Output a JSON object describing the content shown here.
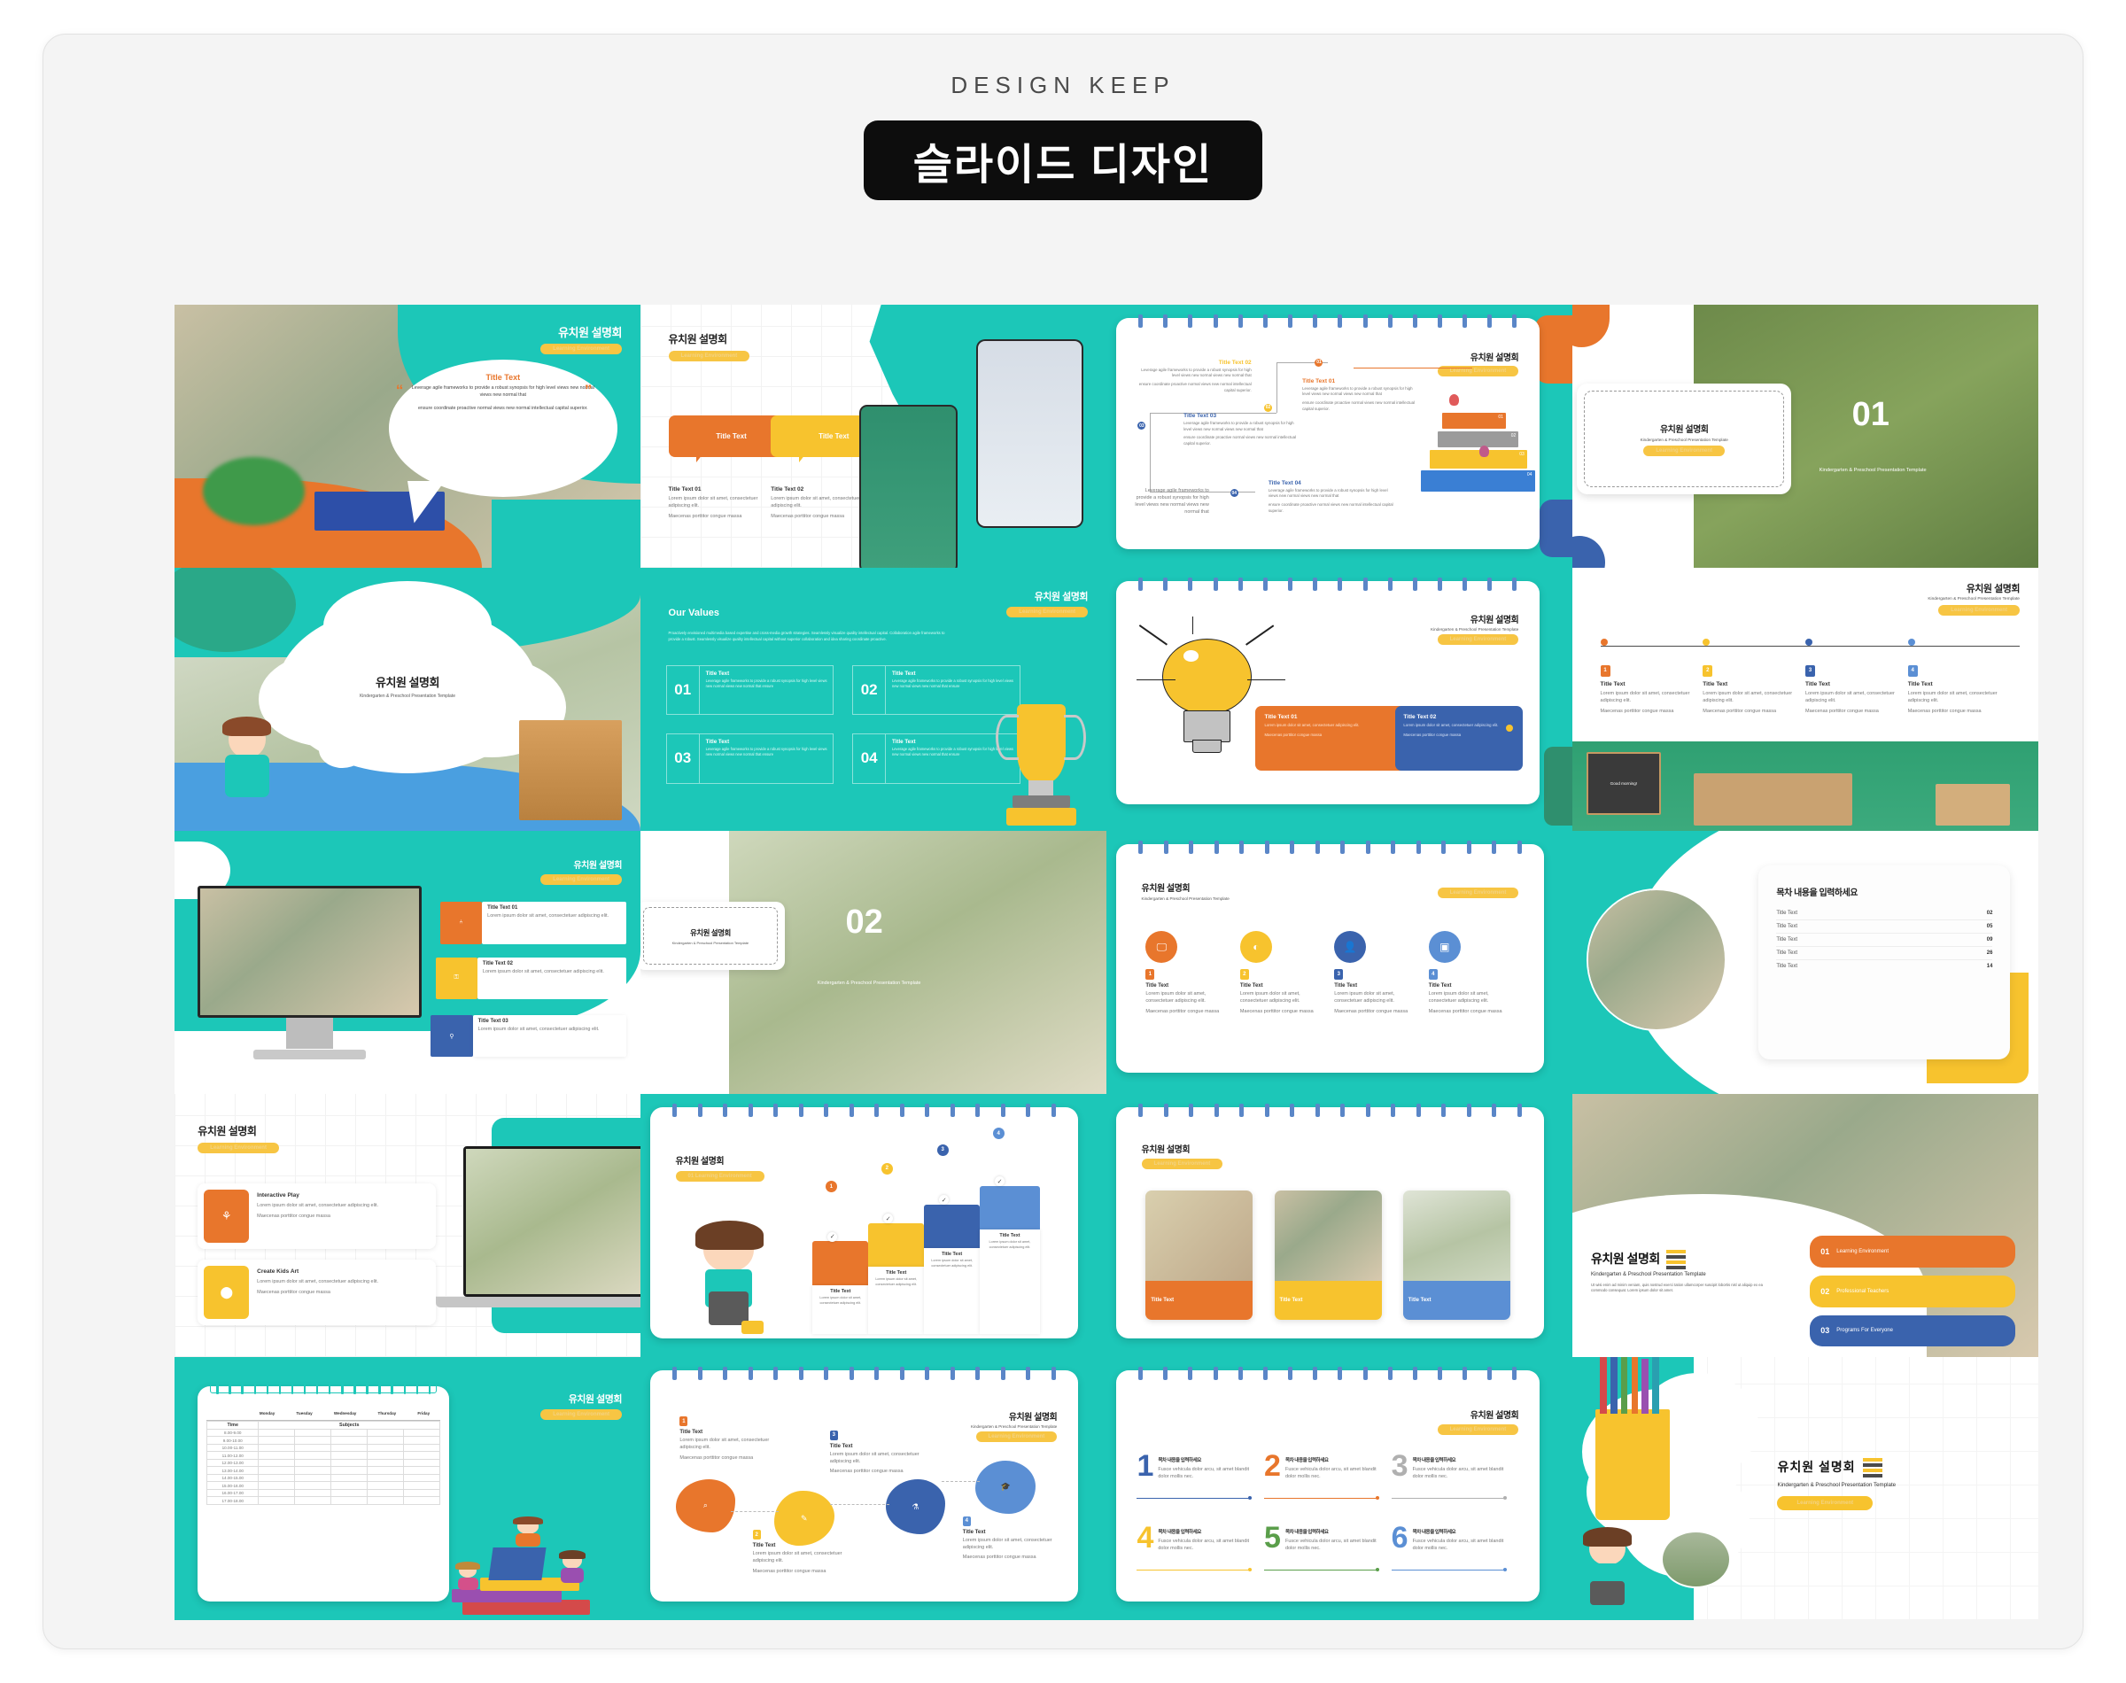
{
  "header": {
    "brand": "DESIGN KEEP",
    "title": "슬라이드 디자인"
  },
  "common": {
    "kor_title": "유치원 설명회",
    "eng_sub": "Kindergarten & Preschool Presentation Template",
    "badge": "Learning Environment",
    "lorem_short": "Lorem ipsum dolor sit amet, consectetuer adipiscing elit.",
    "lorem_maecenas": "Maecenas porttitor congue massa",
    "lorem_long": "Leverage agile frameworks to provide a robust synopsis for high level views new normal views new normal that",
    "lorem_long2": "ensure coordinate proactive normal views new normal intellectual capital superior.",
    "fusce": "Fusce vehicula dolor arcu, sit amet blandit dolor mollis nec."
  },
  "colors": {
    "teal": "#1cc7b8",
    "orange": "#e8762c",
    "yellow": "#f7c32e",
    "blue": "#3a63ad",
    "light_blue": "#5b8fd4",
    "black": "#0d0d0d"
  },
  "slides": [
    {
      "id": "s01",
      "name": "quote-speech-bubble-slide",
      "title": "유치원 설명회",
      "badge": "Learning Environment",
      "quote_title": "Title Text",
      "quote_body_1": "Leverage agile frameworks to provide a robust synopsis for high level views new normal views new normal that",
      "quote_body_2": "ensure coordinate proactive normal views new normal intellectual capital superior."
    },
    {
      "id": "s02",
      "name": "mobile-mockup-two-bubble-slide",
      "title": "유치원 설명회",
      "badge": "Learning Environment",
      "bubbles": [
        "Title Text",
        "Title Text"
      ],
      "items": [
        {
          "heading": "Title Text 01",
          "body": "Lorem ipsum dolor sit amet, consectetuer adipiscing elit.",
          "body2": "Maecenas porttitor congue massa"
        },
        {
          "heading": "Title Text 02",
          "body": "Lorem ipsum dolor sit amet, consectetuer adipiscing elit.",
          "body2": "Maecenas porttitor congue massa"
        }
      ]
    },
    {
      "id": "s03",
      "name": "tree-diagram-four-step-slide",
      "title": "유치원 설명회",
      "badge": "Learning Environment",
      "nodes": [
        {
          "num": "01",
          "heading": "Title Text 01",
          "color": "#e8762c"
        },
        {
          "num": "02",
          "heading": "Title Text 02",
          "color": "#f7c32e"
        },
        {
          "num": "03",
          "heading": "Title Text 03",
          "color": "#3a63ad"
        },
        {
          "num": "04",
          "heading": "Title Text 04",
          "color": "#3a63ad"
        }
      ],
      "body_a": "Leverage agile frameworks to provide a robust synopsis for high level views new normal views new normal that",
      "body_b": "ensure coordinate proactive normal views new normal intellectual capital superior.",
      "blocks": [
        "01",
        "02",
        "03",
        "04"
      ]
    },
    {
      "id": "s04",
      "name": "section-divider-01-slide",
      "title": "유치원 설명회",
      "sub": "Kindergarten & Preschool Presentation Template",
      "badge": "Learning Environment",
      "big_number": "01",
      "overlay_caption": "Kindergarten & Preschool Presentation Template"
    },
    {
      "id": "s05",
      "name": "cloud-cover-title-slide",
      "title": "유치원 설명회",
      "sub": "Kindergarten & Preschool Presentation Template"
    },
    {
      "id": "s06",
      "name": "our-values-four-box-slide",
      "title": "유치원 설명회",
      "badge": "Learning Environment",
      "section_title": "Our Values",
      "intro": "Proactively envisioned multimedia based expertise and cross-media growth strategies. Seamlessly visualize quality intellectual capital. Collaboration agile frameworks to provide a robust. Seamlessly visualize quality intellectual capital without superior collaboration and idea sharing coordinate proactive.",
      "boxes": [
        {
          "num": "01",
          "heading": "Title Text",
          "body": "Leverage agile frameworks to provide a robust synopsis for high level views new normal views new normal that ensure"
        },
        {
          "num": "02",
          "heading": "Title Text",
          "body": "Leverage agile frameworks to provide a robust synopsis for high level views new normal views new normal that ensure"
        },
        {
          "num": "03",
          "heading": "Title Text",
          "body": "Leverage agile frameworks to provide a robust synopsis for high level views new normal views new normal that ensure"
        },
        {
          "num": "04",
          "heading": "Title Text",
          "body": "Leverage agile frameworks to provide a robust synopsis for high level views new normal views new normal that ensure"
        }
      ]
    },
    {
      "id": "s07",
      "name": "lightbulb-two-card-slide",
      "title": "유치원 설명회",
      "sub": "Kindergarten & Preschool Presentation Template",
      "badge": "Learning Environment",
      "cards": [
        {
          "heading": "Title Text 01",
          "body": "Lorem ipsum dolor sit amet, consectetuer adipiscing elit.",
          "body2": "Maecenas porttitor congue massa",
          "color": "#e8762c"
        },
        {
          "heading": "Title Text 02",
          "body": "Lorem ipsum dolor sit amet, consectetuer adipiscing elit.",
          "body2": "Maecenas porttitor congue massa",
          "color": "#3a63ad"
        }
      ]
    },
    {
      "id": "s08",
      "name": "horizontal-timeline-four-step-slide",
      "title": "유치원 설명회",
      "sub": "Kindergarten & Preschool Presentation Template",
      "badge": "Learning Environment",
      "steps": [
        {
          "num": "1",
          "heading": "Title Text",
          "body": "Lorem ipsum dolor sit amet, consectetuer adipiscing elit.",
          "body2": "Maecenas porttitor congue massa",
          "color": "#e8762c"
        },
        {
          "num": "2",
          "heading": "Title Text",
          "body": "Lorem ipsum dolor sit amet, consectetuer adipiscing elit.",
          "body2": "Maecenas porttitor congue massa",
          "color": "#f7c32e"
        },
        {
          "num": "3",
          "heading": "Title Text",
          "body": "Lorem ipsum dolor sit amet, consectetuer adipiscing elit.",
          "body2": "Maecenas porttitor congue massa",
          "color": "#3a63ad"
        },
        {
          "num": "4",
          "heading": "Title Text",
          "body": "Lorem ipsum dolor sit amet, consectetuer adipiscing elit.",
          "body2": "Maecenas porttitor congue massa",
          "color": "#5b8fd4"
        }
      ],
      "blackboard_text": "Good morning!"
    },
    {
      "id": "s09",
      "name": "monitor-puzzle-three-item-slide",
      "title": "유치원 설명회",
      "badge": "Learning Environment",
      "items": [
        {
          "heading": "Title Text 01",
          "body": "Lorem ipsum dolor sit amet, consectetuer adipiscing elit.",
          "icon": "cutlery-icon",
          "color": "#e8762c"
        },
        {
          "heading": "Title Text 02",
          "body": "Lorem ipsum dolor sit amet, consectetuer adipiscing elit.",
          "icon": "key-icon",
          "color": "#f7c32e"
        },
        {
          "heading": "Title Text 03",
          "body": "Lorem ipsum dolor sit amet, consectetuer adipiscing elit.",
          "icon": "magnifier-icon",
          "color": "#3a63ad"
        }
      ]
    },
    {
      "id": "s10",
      "name": "section-divider-02-slide",
      "title": "유치원 설명회",
      "sub": "Kindergarten & Preschool Presentation Template",
      "big_number": "02",
      "overlay_caption": "Kindergarten & Preschool Presentation Template"
    },
    {
      "id": "s11",
      "name": "four-circle-icon-slide",
      "title": "유치원 설명회",
      "sub": "Kindergarten & Preschool Presentation Template",
      "badge": "Learning Environment",
      "items": [
        {
          "num": "1",
          "heading": "Title Text",
          "body": "Lorem ipsum dolor sit amet, consectetuer adipiscing elit.",
          "body2": "Maecenas porttitor congue massa",
          "icon": "monitor-icon",
          "color": "#e8762c"
        },
        {
          "num": "2",
          "heading": "Title Text",
          "body": "Lorem ipsum dolor sit amet, consectetuer adipiscing elit.",
          "body2": "Maecenas porttitor congue massa",
          "icon": "palette-icon",
          "color": "#f7c32e"
        },
        {
          "num": "3",
          "heading": "Title Text",
          "body": "Lorem ipsum dolor sit amet, consectetuer adipiscing elit.",
          "body2": "Maecenas porttitor congue massa",
          "icon": "teacher-icon",
          "color": "#3a63ad"
        },
        {
          "num": "4",
          "heading": "Title Text",
          "body": "Lorem ipsum dolor sit amet, consectetuer adipiscing elit.",
          "body2": "Maecenas porttitor congue massa",
          "icon": "presentation-icon",
          "color": "#5b8fd4"
        }
      ]
    },
    {
      "id": "s12",
      "name": "table-of-contents-slide",
      "toc_title": "목차 내용을 입력하세요",
      "rows": [
        {
          "label": "Title Text",
          "page": "02"
        },
        {
          "label": "Title Text",
          "page": "05"
        },
        {
          "label": "Title Text",
          "page": "09"
        },
        {
          "label": "Title Text",
          "page": "26"
        },
        {
          "label": "Title Text",
          "page": "14"
        }
      ]
    },
    {
      "id": "s13",
      "name": "laptop-two-feature-slide",
      "title": "유치원 설명회",
      "badge": "Learning Environment",
      "features": [
        {
          "heading": "Interactive Play",
          "body": "Lorem ipsum dolor sit amet, consectetuer adipiscing elit.",
          "body2": "Maecenas porttitor congue massa",
          "icon": "rocking-horse-icon",
          "color": "#e8762c"
        },
        {
          "heading": "Create Kids Art",
          "body": "Lorem ipsum dolor sit amet, consectetuer adipiscing elit.",
          "body2": "Maecenas porttitor congue massa",
          "icon": "basketball-icon",
          "color": "#f7c32e"
        }
      ]
    },
    {
      "id": "s14",
      "name": "staircase-four-step-slide",
      "title": "유치원 설명회",
      "badge": "01 Learning Environment",
      "steps": [
        {
          "num": "1",
          "heading": "Title Text",
          "body": "Lorem ipsum dolor sit amet, consectetuer adipiscing elit.",
          "body2": "Maecenas porttitor congue massa",
          "color": "#e8762c"
        },
        {
          "num": "2",
          "heading": "Title Text",
          "body": "Lorem ipsum dolor sit amet, consectetuer adipiscing elit.",
          "body2": "Maecenas porttitor congue massa",
          "color": "#f7c32e"
        },
        {
          "num": "3",
          "heading": "Title Text",
          "body": "Lorem ipsum dolor sit amet, consectetuer adipiscing elit.",
          "body2": "Maecenas porttitor congue massa",
          "color": "#3a63ad"
        },
        {
          "num": "4",
          "heading": "Title Text",
          "body": "Lorem ipsum dolor sit amet, consectetuer adipiscing elit.",
          "body2": "Maecenas porttitor congue massa",
          "color": "#5b8fd4"
        }
      ]
    },
    {
      "id": "s15",
      "name": "three-photo-card-slide",
      "title": "유치원 설명회",
      "badge": "Learning Environment",
      "cards": [
        {
          "heading": "Title Text",
          "color": "#e8762c"
        },
        {
          "heading": "Title Text",
          "color": "#f7c32e"
        },
        {
          "heading": "Title Text",
          "color": "#5b8fd4"
        }
      ]
    },
    {
      "id": "s16",
      "name": "hero-three-pill-slide",
      "title": "유치원 설명회",
      "sub": "Kindergarten & Preschool Presentation Template",
      "body": "Ut wisi enim ad minim veniam, quis nostrud exerci tation ullamcorper suscipit lobortis nisl ut aliquip ex ea commodo consequat. Lorem ipsum dolor sit amet.",
      "pills": [
        {
          "num": "01",
          "label": "Learning Environment",
          "color": "#e8762c"
        },
        {
          "num": "02",
          "label": "Professional Teachers",
          "color": "#f7c32e"
        },
        {
          "num": "03",
          "label": "Programs For Everyone",
          "color": "#3a63ad"
        }
      ]
    },
    {
      "id": "s17",
      "name": "weekly-schedule-table-slide",
      "title": "유치원 설명회",
      "badge": "Learning Environment",
      "days": [
        "Monday",
        "Tuesday",
        "Wednesday",
        "Thursday",
        "Friday"
      ],
      "col_time": "Time",
      "col_subjects": "Subjects",
      "times": [
        "8.00-9.00",
        "9.00-10.00",
        "10.00-11.00",
        "11.00-12.00",
        "12.00-13.00",
        "13.00-14.00",
        "14.00-15.00",
        "15.00-16.00",
        "16.00-17.00",
        "17.00-18.00"
      ]
    },
    {
      "id": "s18",
      "name": "zigzag-four-blob-slide",
      "title": "유치원 설명회",
      "sub": "Kindergarten & Preschool Presentation Template",
      "badge": "Learning Environment",
      "nodes": [
        {
          "num": "1",
          "heading": "Title Text",
          "body": "Lorem ipsum dolor sit amet, consectetuer adipiscing elit.",
          "body2": "Maecenas porttitor congue massa",
          "icon": "book-search-icon",
          "color": "#e8762c"
        },
        {
          "num": "2",
          "heading": "Title Text",
          "body": "Lorem ipsum dolor sit amet, consectetuer adipiscing elit.",
          "body2": "Maecenas porttitor congue massa",
          "icon": "pencil-icon",
          "color": "#f7c32e"
        },
        {
          "num": "3",
          "heading": "Title Text",
          "body": "Lorem ipsum dolor sit amet, consectetuer adipiscing elit.",
          "body2": "Maecenas porttitor congue massa",
          "icon": "flask-icon",
          "color": "#3a63ad"
        },
        {
          "num": "4",
          "heading": "Title Text",
          "body": "Lorem ipsum dolor sit amet, consectetuer adipiscing elit.",
          "body2": "Maecenas porttitor congue massa",
          "icon": "graduation-cap-icon",
          "color": "#5b8fd4"
        }
      ]
    },
    {
      "id": "s19",
      "name": "six-number-list-slide",
      "title": "유치원 설명회",
      "badge": "Learning Environment",
      "items": [
        {
          "num": "1",
          "heading": "목차 내용을 입력하세요",
          "body": "Fusce vehicula dolor arcu, sit amet blandit dolor mollis nec.",
          "color": "#3a63ad"
        },
        {
          "num": "2",
          "heading": "목차 내용을 입력하세요",
          "body": "Fusce vehicula dolor arcu, sit amet blandit dolor mollis nec.",
          "color": "#e8762c"
        },
        {
          "num": "3",
          "heading": "목차 내용을 입력하세요",
          "body": "Fusce vehicula dolor arcu, sit amet blandit dolor mollis nec.",
          "color": "#b0b0b0"
        },
        {
          "num": "4",
          "heading": "목차 내용을 입력하세요",
          "body": "Fusce vehicula dolor arcu, sit amet blandit dolor mollis nec.",
          "color": "#f7c32e"
        },
        {
          "num": "5",
          "heading": "목차 내용을 입력하세요",
          "body": "Fusce vehicula dolor arcu, sit amet blandit dolor mollis nec.",
          "color": "#5a9e4a"
        },
        {
          "num": "6",
          "heading": "목차 내용을 입력하세요",
          "body": "Fusce vehicula dolor arcu, sit amet blandit dolor mollis nec.",
          "color": "#5b8fd4"
        }
      ]
    },
    {
      "id": "s20",
      "name": "closing-cloud-title-slide",
      "title": "유치원 설명회",
      "sub": "Kindergarten & Preschool Presentation Template",
      "badge": "Learning Environment"
    }
  ]
}
